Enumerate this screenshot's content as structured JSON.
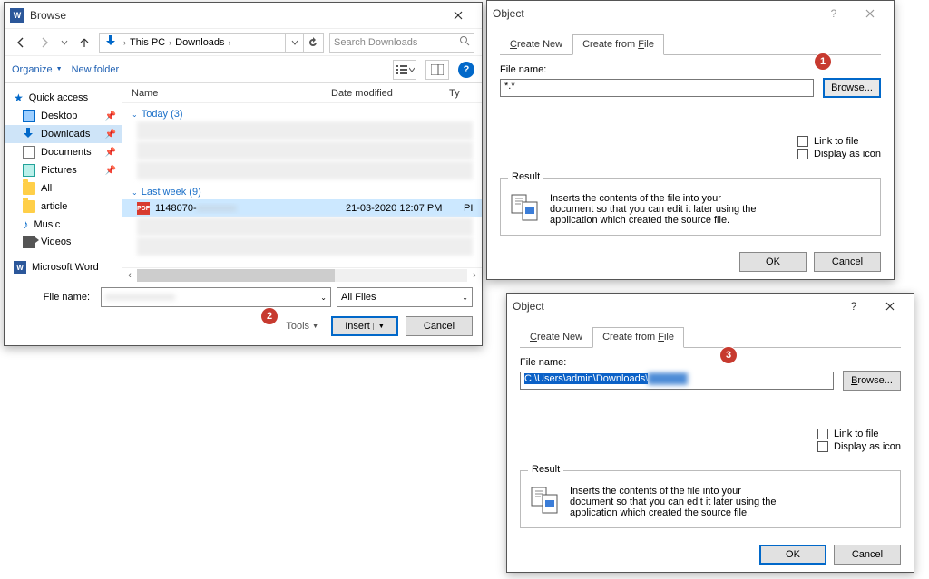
{
  "browse": {
    "title": "Browse",
    "breadcrumb": {
      "seg1": "This PC",
      "seg2": "Downloads"
    },
    "search_placeholder": "Search Downloads",
    "organize": "Organize",
    "newfolder": "New folder",
    "sidebar": {
      "quick": "Quick access",
      "desktop": "Desktop",
      "downloads": "Downloads",
      "documents": "Documents",
      "pictures": "Pictures",
      "all": "All",
      "article": "article",
      "music": "Music",
      "videos": "Videos",
      "msword": "Microsoft Word"
    },
    "cols": {
      "name": "Name",
      "date": "Date modified",
      "type": "Ty"
    },
    "groups": {
      "today": "Today (3)",
      "lastweek": "Last week (9)"
    },
    "pdfrow": {
      "icon": "PDF",
      "name": "1148070-",
      "date": "21-03-2020 12:07 PM",
      "type": "PI"
    },
    "filename_label": "File name:",
    "filter": "All Files",
    "tools": "Tools",
    "insert": "Insert",
    "cancel": "Cancel"
  },
  "object": {
    "title": "Object",
    "tab_create_new": "Create New",
    "tab_create_file": "Create from File",
    "tab_create_new_u": "C",
    "tab_create_file_u": "F",
    "filename_label": "File name:",
    "browse": "Browse...",
    "browse_u": "B",
    "linktofile": "Link to file",
    "displayicon": "Display as icon",
    "result": "Result",
    "resulttext": "Inserts the contents of the file into your document so that you can edit it later using the application which created the source file.",
    "ok": "OK",
    "cancel": "Cancel",
    "filename1": "*.*",
    "filename2": "C:\\Users\\admin\\Downloads\\"
  },
  "badges": {
    "b1": "1",
    "b2": "2",
    "b3": "3"
  }
}
